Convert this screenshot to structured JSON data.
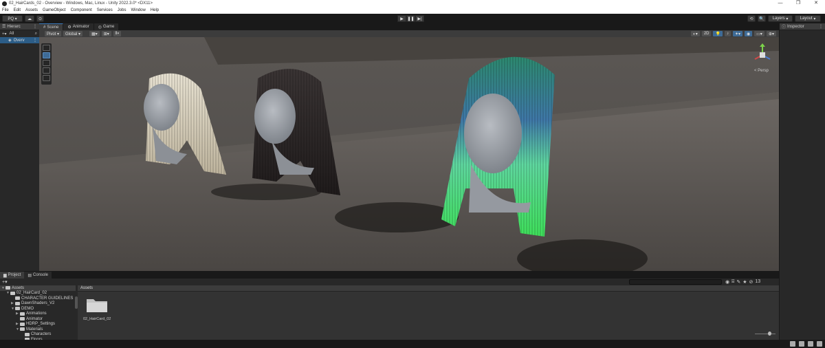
{
  "window": {
    "title": "02_HairCards_02 - Overview - Windows, Mac, Linux - Unity 2022.3.0* <DX11>",
    "controls": [
      "—",
      "❐",
      "✕"
    ]
  },
  "menu": [
    "File",
    "Edit",
    "Assets",
    "GameObject",
    "Component",
    "Services",
    "Jobs",
    "Window",
    "Help"
  ],
  "toolbar": {
    "account": "PQ ▾",
    "cloud": "☁",
    "collab": "⊙",
    "play": "▶",
    "pause": "❚❚",
    "step": "▶|",
    "history": "⟲",
    "search": "🔍",
    "layers": "Layers",
    "layout": "Layout"
  },
  "hierarchy": {
    "tab": "Hierarc",
    "add": "+▾",
    "filter": "All",
    "item": "Overv"
  },
  "scene_tabs": [
    "Scene",
    "Animator",
    "Game"
  ],
  "scene_toolbar": {
    "pivot": "Pivot ▾",
    "global": "Global ▾",
    "mode_2d": "2D",
    "gizmo_label": "< Persp"
  },
  "inspector": {
    "tab": "Inspector"
  },
  "project": {
    "tabs": [
      "Project",
      "Console"
    ],
    "add": "+▾",
    "assets_header": "Assets",
    "tree": [
      {
        "label": "Assets",
        "depth": 0,
        "arrow": "▼"
      },
      {
        "label": "02_HairCard_02",
        "depth": 1,
        "arrow": "▼"
      },
      {
        "label": "CHARACTER GUIDELINES",
        "depth": 2,
        "arrow": ""
      },
      {
        "label": "DawnShaders_V2",
        "depth": 2,
        "arrow": "▶"
      },
      {
        "label": "DEMO",
        "depth": 2,
        "arrow": "▼"
      },
      {
        "label": "Animations",
        "depth": 3,
        "arrow": "▶"
      },
      {
        "label": "Animator",
        "depth": 3,
        "arrow": ""
      },
      {
        "label": "HDRP_Settings",
        "depth": 3,
        "arrow": "▶"
      },
      {
        "label": "Materials",
        "depth": 3,
        "arrow": "▼"
      },
      {
        "label": "Characters",
        "depth": 4,
        "arrow": ""
      },
      {
        "label": "Floors",
        "depth": 4,
        "arrow": ""
      }
    ],
    "asset_items": [
      {
        "label": "02_HairCard_02"
      }
    ],
    "count": "13"
  }
}
